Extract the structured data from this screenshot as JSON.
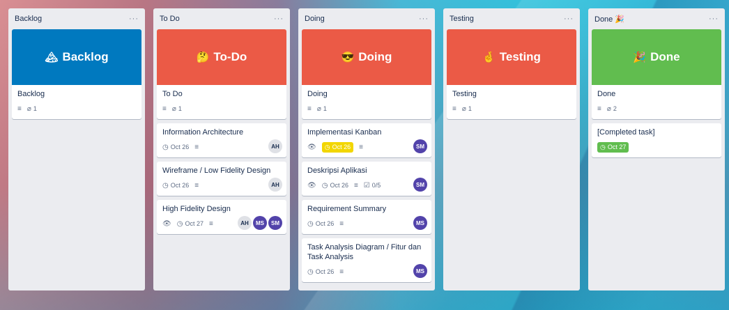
{
  "lists": [
    {
      "title": "Backlog",
      "menu": "···",
      "cover": {
        "emoji": "🏔",
        "label": "Backlog",
        "color": "#0079bf"
      },
      "cover_card": {
        "title": "Backlog",
        "attachments": "1"
      }
    },
    {
      "title": "To Do",
      "menu": "···",
      "cover": {
        "emoji": "🤔",
        "label": "To-Do",
        "color": "#eb5a46"
      },
      "cover_card": {
        "title": "To Do",
        "attachments": "1"
      },
      "cards": [
        {
          "title": "Information Architecture",
          "due": "Oct 26",
          "members": [
            "AH"
          ]
        },
        {
          "title": "Wireframe / Low Fidelity Design",
          "due": "Oct 26",
          "members": [
            "AH"
          ]
        },
        {
          "title": "High Fidelity Design",
          "due": "Oct 27",
          "members": [
            "AH",
            "MS",
            "SM"
          ]
        }
      ]
    },
    {
      "title": "Doing",
      "menu": "···",
      "cover": {
        "emoji": "😎",
        "label": "Doing",
        "color": "#eb5a46"
      },
      "cover_card": {
        "title": "Doing",
        "attachments": "1"
      },
      "cards": [
        {
          "title": "Implementasi Kanban",
          "due": "Oct 26",
          "members": [
            "SM"
          ]
        },
        {
          "title": "Deskripsi Aplikasi",
          "due": "Oct 26",
          "checklist": "0/5",
          "members": [
            "SM"
          ]
        },
        {
          "title": "Requirement Summary",
          "due": "Oct 26",
          "members": [
            "MS"
          ]
        },
        {
          "title": "Task Analysis Diagram / Fitur dan Task Analysis",
          "due": "Oct 26",
          "members": [
            "MS"
          ]
        }
      ]
    },
    {
      "title": "Testing",
      "menu": "···",
      "cover": {
        "emoji": "🤞",
        "label": "Testing",
        "color": "#eb5a46"
      },
      "cover_card": {
        "title": "Testing",
        "attachments": "1"
      }
    },
    {
      "title": "Done 🎉",
      "menu": "···",
      "cover": {
        "emoji": "🎉",
        "label": "Done",
        "color": "#61bd4f"
      },
      "cover_card": {
        "title": "Done",
        "attachments": "2"
      },
      "cards": [
        {
          "title": "[Completed task]",
          "due": "Oct 27"
        }
      ]
    }
  ],
  "icons": {
    "description": "≡",
    "attachment": "🔗",
    "watch": "👁",
    "clock": "◷",
    "checklist": "☑"
  },
  "colors": {
    "due_soon": "#f2d600",
    "due_complete": "#61bd4f",
    "avatar_purple": "#5243aa"
  }
}
